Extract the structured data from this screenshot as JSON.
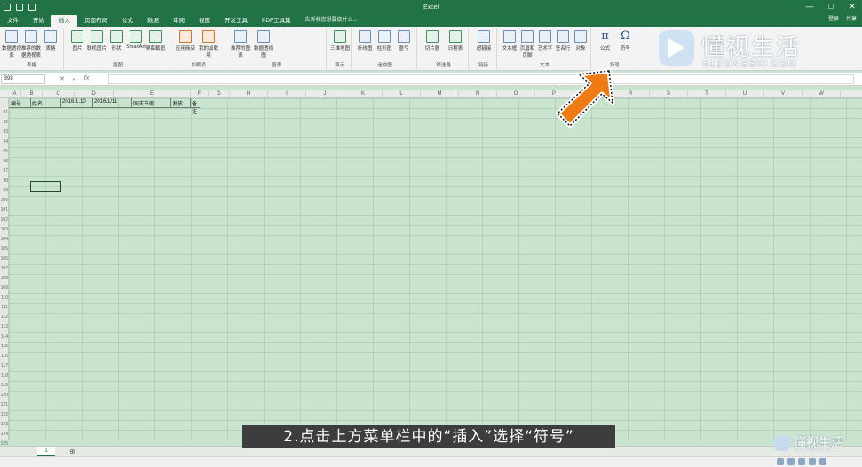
{
  "window": {
    "title": "Excel",
    "controls": [
      "—",
      "□",
      "✕"
    ]
  },
  "tabs": [
    {
      "label": "文件"
    },
    {
      "label": "开始"
    },
    {
      "label": "插入",
      "active": true
    },
    {
      "label": "页面布局"
    },
    {
      "label": "公式"
    },
    {
      "label": "数据"
    },
    {
      "label": "审阅"
    },
    {
      "label": "视图"
    },
    {
      "label": "开发工具"
    },
    {
      "label": "PDF工具集"
    }
  ],
  "tell_me": "告诉我您想要做什么...",
  "user": {
    "login": "登录",
    "share": "共享"
  },
  "ribbon": {
    "groups": [
      {
        "label": "表格",
        "buttons": [
          "数据透视表",
          "推荐的数据透视表",
          "表格"
        ]
      },
      {
        "label": "插图",
        "buttons": [
          "图片",
          "联机图片",
          "形状",
          "SmartArt",
          "屏幕截图"
        ]
      },
      {
        "label": "加载项",
        "buttons": [
          "应用商店",
          "我的加载项"
        ]
      },
      {
        "label": "图表",
        "buttons": [
          "推荐的图表",
          "数据透视图"
        ]
      },
      {
        "label": "演示",
        "buttons": [
          "三维地图"
        ]
      },
      {
        "label": "迷你图",
        "buttons": [
          "折线图",
          "柱形图",
          "盈亏"
        ]
      },
      {
        "label": "筛选器",
        "buttons": [
          "切片器",
          "日程表"
        ]
      },
      {
        "label": "链接",
        "buttons": [
          "超链接"
        ]
      },
      {
        "label": "文本",
        "buttons": [
          "文本框",
          "页眉和页脚",
          "艺术字",
          "签名行",
          "对象"
        ]
      },
      {
        "label": "符号",
        "buttons": [
          "公式",
          "符号"
        ]
      }
    ],
    "symbol_glyphs": {
      "equation": "π",
      "symbol": "Ω"
    }
  },
  "formula_bar": {
    "name_box": "B98",
    "cancel": "✕",
    "confirm": "✓",
    "fx": "fx"
  },
  "columns": [
    "A",
    "B",
    "C",
    "D",
    "E",
    "F",
    "G",
    "H",
    "I",
    "J",
    "K",
    "L",
    "M",
    "N",
    "O",
    "P",
    "Q",
    "R",
    "S",
    "T",
    "U",
    "V",
    "W"
  ],
  "rows": [
    "91",
    "92",
    "93",
    "94",
    "95",
    "96",
    "97",
    "98",
    "99",
    "100",
    "101",
    "102",
    "103",
    "104",
    "105",
    "106",
    "107",
    "108",
    "109",
    "110",
    "111",
    "112",
    "113",
    "114",
    "115",
    "116",
    "117",
    "118",
    "119",
    "120",
    "121",
    "122",
    "123",
    "124",
    "125"
  ],
  "row1_cells": [
    "编号",
    "姓名",
    "2016.1.10",
    "2016/1/11",
    "国庆节假",
    "发放",
    "备注"
  ],
  "sheet": {
    "tab": "1",
    "add": "⊕"
  },
  "logo": {
    "cn": "懂视生活",
    "en": "51DONGSHI.COM"
  },
  "caption": "2.点击上方菜单栏中的“插入”选择“符号”",
  "colors": {
    "excel_green": "#217346",
    "grid_bg": "#c9e4cf",
    "arrow_orange": "#f07a14"
  }
}
